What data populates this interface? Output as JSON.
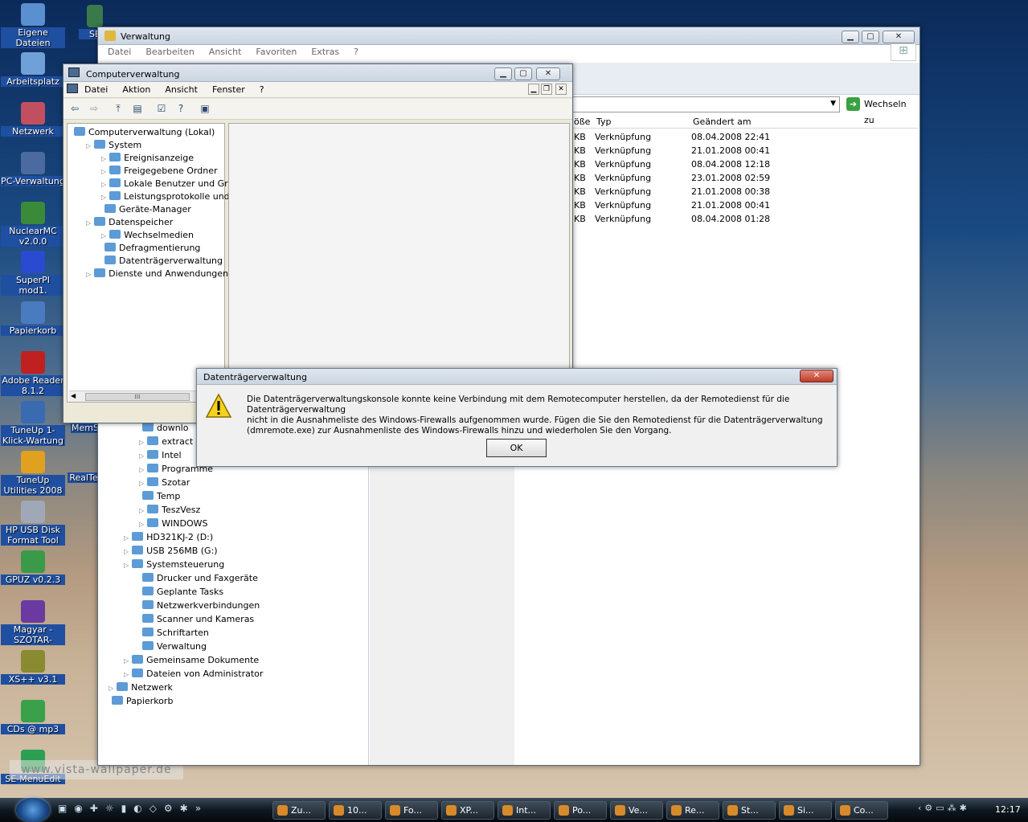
{
  "desktop_icons": [
    {
      "label": "Eigene Dateien",
      "color": "#5a8fd0"
    },
    {
      "label": "Arbeitsplatz",
      "color": "#6fa0d8"
    },
    {
      "label": "Netzwerk",
      "color": "#c05060"
    },
    {
      "label": "PC-Verwaltung",
      "color": "#4a6aa0"
    },
    {
      "label": "NuclearMC v2.0.0",
      "color": "#3a8a3a"
    },
    {
      "label": "SuperPI mod1.",
      "color": "#2a4ad0"
    },
    {
      "label": "Papierkorb",
      "color": "#4a7ac0"
    },
    {
      "label": "Adobe Reader 8.1.2",
      "color": "#c02020"
    },
    {
      "label": "TuneUp 1-Klick-Wartung",
      "color": "#3a6ab0"
    },
    {
      "label": "TuneUp Utilities 2008",
      "color": "#e0a020"
    },
    {
      "label": "HP USB Disk Format Tool",
      "color": "#a0a8b8"
    },
    {
      "label": "GPUZ v0.2.3",
      "color": "#3a9a4a"
    },
    {
      "label": "Magyar -SZOTAR-",
      "color": "#6a3aa0"
    },
    {
      "label": "XS++ v3.1",
      "color": "#8a8a30"
    },
    {
      "label": "CDs @ mp3",
      "color": "#3aa04a"
    },
    {
      "label": "SE-MenuEdit",
      "color": "#2aa050"
    }
  ],
  "desktop_partial": {
    "se": "SE",
    "mems": "MemS",
    "realte": "RealTe"
  },
  "watermark": "www.vista-wallpaper.de",
  "explorer": {
    "title": "Verwaltung",
    "menu": [
      "Datei",
      "Bearbeiten",
      "Ansicht",
      "Favoriten",
      "Extras",
      "?"
    ],
    "go_label": "Wechseln zu",
    "columns": [
      "öße",
      "Typ",
      "Geändert am"
    ],
    "rows": [
      {
        "size": "KB",
        "type": "Verknüpfung",
        "date": "08.04.2008 22:41"
      },
      {
        "size": "KB",
        "type": "Verknüpfung",
        "date": "21.01.2008 00:41"
      },
      {
        "size": "KB",
        "type": "Verknüpfung",
        "date": "08.04.2008 12:18"
      },
      {
        "size": "KB",
        "type": "Verknüpfung",
        "date": "23.01.2008 02:59"
      },
      {
        "size": "KB",
        "type": "Verknüpfung",
        "date": "21.01.2008 00:38"
      },
      {
        "size": "KB",
        "type": "Verknüpfung",
        "date": "21.01.2008 00:41"
      },
      {
        "size": "KB",
        "type": "Verknüpfung",
        "date": "08.04.2008 01:28"
      }
    ],
    "tree": [
      {
        "label": "downlo",
        "indent": 3,
        "exp": false
      },
      {
        "label": "extract",
        "indent": 3,
        "exp": true
      },
      {
        "label": "Intel",
        "indent": 3,
        "exp": true
      },
      {
        "label": "Programme",
        "indent": 3,
        "exp": true
      },
      {
        "label": "Szotar",
        "indent": 3,
        "exp": true
      },
      {
        "label": "Temp",
        "indent": 3,
        "exp": false
      },
      {
        "label": "TeszVesz",
        "indent": 3,
        "exp": true
      },
      {
        "label": "WINDOWS",
        "indent": 3,
        "exp": true
      },
      {
        "label": "HD321KJ-2 (D:)",
        "indent": 2,
        "exp": true
      },
      {
        "label": "USB 256MB (G:)",
        "indent": 2,
        "exp": true
      },
      {
        "label": "Systemsteuerung",
        "indent": 2,
        "exp": true
      },
      {
        "label": "Drucker und Faxgeräte",
        "indent": 3,
        "exp": false
      },
      {
        "label": "Geplante Tasks",
        "indent": 3,
        "exp": false
      },
      {
        "label": "Netzwerkverbindungen",
        "indent": 3,
        "exp": false
      },
      {
        "label": "Scanner und Kameras",
        "indent": 3,
        "exp": false
      },
      {
        "label": "Schriftarten",
        "indent": 3,
        "exp": false
      },
      {
        "label": "Verwaltung",
        "indent": 3,
        "exp": false
      },
      {
        "label": "Gemeinsame Dokumente",
        "indent": 2,
        "exp": true
      },
      {
        "label": "Dateien von Administrator",
        "indent": 2,
        "exp": true
      },
      {
        "label": "Netzwerk",
        "indent": 1,
        "exp": true
      },
      {
        "label": "Papierkorb",
        "indent": 1,
        "exp": false
      }
    ]
  },
  "compmgmt": {
    "title": "Computerverwaltung",
    "menu": [
      "Datei",
      "Aktion",
      "Ansicht",
      "Fenster",
      "?"
    ],
    "tree": [
      {
        "label": "Computerverwaltung (Lokal)",
        "indent": 0,
        "exp": false
      },
      {
        "label": "System",
        "indent": 1,
        "exp": true
      },
      {
        "label": "Ereignisanzeige",
        "indent": 2,
        "exp": true
      },
      {
        "label": "Freigegebene Ordner",
        "indent": 2,
        "exp": true
      },
      {
        "label": "Lokale Benutzer und Gruppe",
        "indent": 2,
        "exp": true
      },
      {
        "label": "Leistungsprotokolle und War",
        "indent": 2,
        "exp": true
      },
      {
        "label": "Geräte-Manager",
        "indent": 2,
        "exp": false
      },
      {
        "label": "Datenspeicher",
        "indent": 1,
        "exp": true
      },
      {
        "label": "Wechselmedien",
        "indent": 2,
        "exp": true
      },
      {
        "label": "Defragmentierung",
        "indent": 2,
        "exp": false
      },
      {
        "label": "Datenträgerverwaltung",
        "indent": 2,
        "exp": false
      },
      {
        "label": "Dienste und Anwendungen",
        "indent": 1,
        "exp": true
      }
    ]
  },
  "dialog": {
    "title": "Datenträgerverwaltung",
    "lines": [
      "Die Datenträgerverwaltungskonsole konnte keine Verbindung mit dem Remotecomputer herstellen, da der Remotedienst für die Datenträgerverwaltung",
      "nicht in die Ausnahmeliste des Windows-Firewalls aufgenommen wurde. Fügen die Sie den Remotedienst für die Datenträgerverwaltung",
      "(dmremote.exe) zur Ausnahmenliste des Windows-Firewalls hinzu und wiederholen Sie den Vorgang."
    ],
    "ok": "OK"
  },
  "taskbar": {
    "buttons": [
      "Zu...",
      "10...",
      "Fo...",
      "XP...",
      "Int...",
      "Po...",
      "Ve...",
      "Re...",
      "St...",
      "Si...",
      "Co..."
    ],
    "clock": "12:17"
  }
}
